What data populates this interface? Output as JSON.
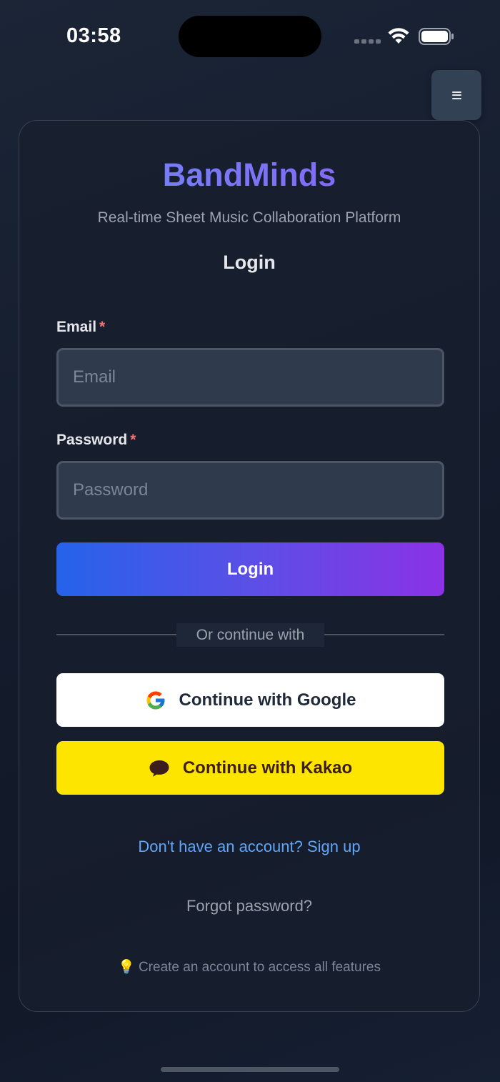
{
  "status_bar": {
    "time": "03:58"
  },
  "menu": {
    "icon": "hamburger-icon"
  },
  "app": {
    "brand": "BandMinds",
    "tagline": "Real-time Sheet Music Collaboration Platform",
    "form_title": "Login"
  },
  "form": {
    "email_label": "Email",
    "email_required_mark": "*",
    "email_placeholder": "Email",
    "email_value": "",
    "password_label": "Password",
    "password_required_mark": "*",
    "password_placeholder": "Password",
    "password_value": "",
    "submit_label": "Login"
  },
  "social": {
    "divider_text": "Or continue with",
    "google_label": "Continue with Google",
    "google_icon": "google-logo-icon",
    "kakao_label": "Continue with Kakao",
    "kakao_icon": "speech-bubble-icon"
  },
  "links": {
    "signup": "Don't have an account? Sign up",
    "forgot_password": "Forgot password?"
  },
  "hint": {
    "icon": "💡",
    "text": "Create an account to access all features"
  },
  "colors": {
    "background": "#151d2e",
    "brand_gradient_start": "#6d8cf6",
    "brand_gradient_end": "#8b5cf6",
    "login_gradient_start": "#2563eb",
    "login_gradient_end": "#8b32e6",
    "kakao_yellow": "#fee500",
    "link_blue": "#60a5fa",
    "required_red": "#f87171"
  }
}
